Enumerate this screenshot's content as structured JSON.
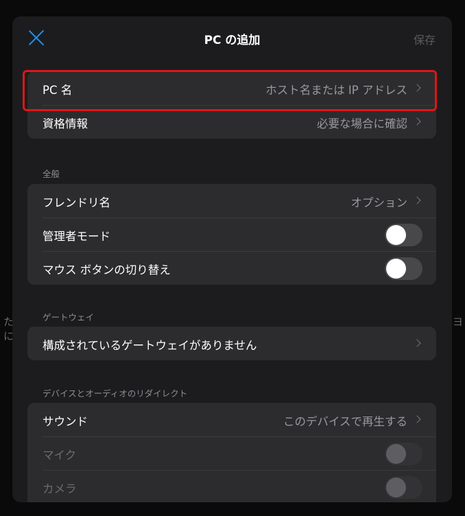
{
  "background": {
    "left_fragment": "たに",
    "right_fragment": "ヨ"
  },
  "header": {
    "title": "PC の追加",
    "save_label": "保存"
  },
  "pc_group": {
    "pc_name": {
      "label": "PC 名",
      "value": "ホスト名または IP アドレス"
    },
    "credentials": {
      "label": "資格情報",
      "value": "必要な場合に確認"
    }
  },
  "general": {
    "header": "全般",
    "friendly_name": {
      "label": "フレンドリ名",
      "value": "オプション"
    },
    "admin_mode": {
      "label": "管理者モード",
      "on": false
    },
    "swap_mouse": {
      "label": "マウス ボタンの切り替え",
      "on": false
    }
  },
  "gateway": {
    "header": "ゲートウェイ",
    "label": "構成されているゲートウェイがありません"
  },
  "redirect": {
    "header": "デバイスとオーディオのリダイレクト",
    "sound": {
      "label": "サウンド",
      "value": "このデバイスで再生する"
    },
    "mic": {
      "label": "マイク",
      "on": false,
      "enabled": false
    },
    "camera": {
      "label": "カメラ",
      "on": false,
      "enabled": false
    }
  },
  "colors": {
    "accent": "#1e8ff2",
    "highlight": "#e01616",
    "sheet": "#1c1c1e",
    "cell": "#2c2c2e"
  }
}
